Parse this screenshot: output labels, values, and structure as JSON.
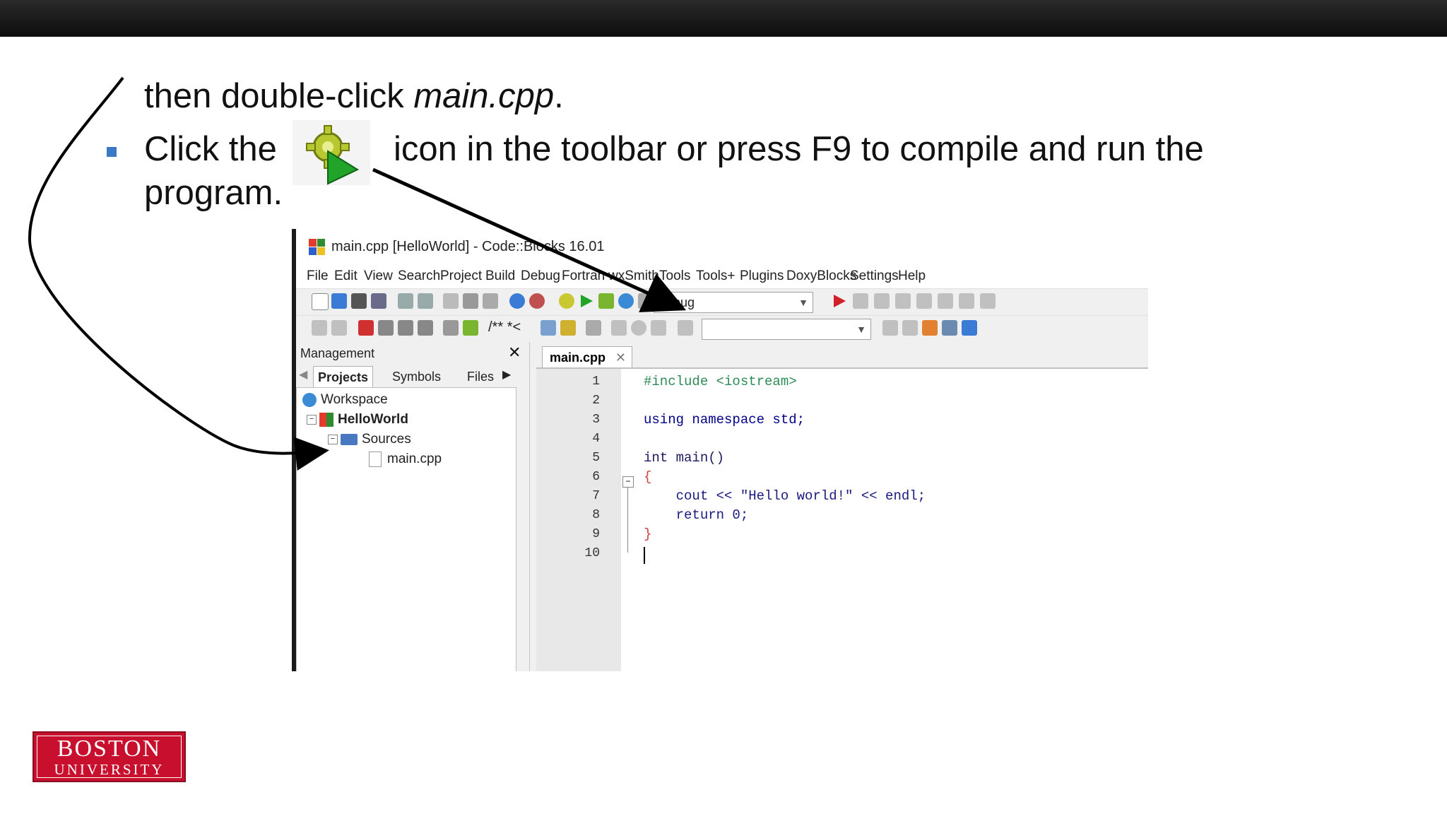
{
  "slide": {
    "line1_prefix": "then double-click ",
    "line1_file": "main.cpp",
    "line1_suffix": ".",
    "line2_before_icon": "Click the",
    "line2_after_icon": "icon in the toolbar or press F9 to compile and run the",
    "line3": "program.",
    "logo_line1": "BOSTON",
    "logo_line2": "UNIVERSITY",
    "bullet_color": "#3b78c5"
  },
  "window": {
    "title": "main.cpp [HelloWorld] - Code::Blocks 16.01"
  },
  "menu": [
    "File",
    "Edit",
    "View",
    "Search",
    "Project",
    "Build",
    "Debug",
    "Fortran",
    "wxSmith",
    "Tools",
    "Tools+",
    "Plugins",
    "DoxyBlocks",
    "Settings",
    "Help"
  ],
  "toolbar": {
    "build_target": "Debug",
    "comment_label": "/** *<",
    "build_run_icon": "build-and-run-icon"
  },
  "management": {
    "title": "Management",
    "tabs": [
      "Projects",
      "Symbols",
      "Files"
    ],
    "tree": {
      "workspace": "Workspace",
      "project": "HelloWorld",
      "folder": "Sources",
      "file": "main.cpp"
    }
  },
  "editor": {
    "tab": "main.cpp",
    "line_numbers": [
      "1",
      "2",
      "3",
      "4",
      "5",
      "6",
      "7",
      "8",
      "9",
      "10"
    ],
    "lines": [
      "#include <iostream>",
      "",
      "using namespace std;",
      "",
      "int main()",
      "{",
      "    cout << \"Hello world!\" << endl;",
      "    return 0;",
      "}",
      ""
    ]
  }
}
